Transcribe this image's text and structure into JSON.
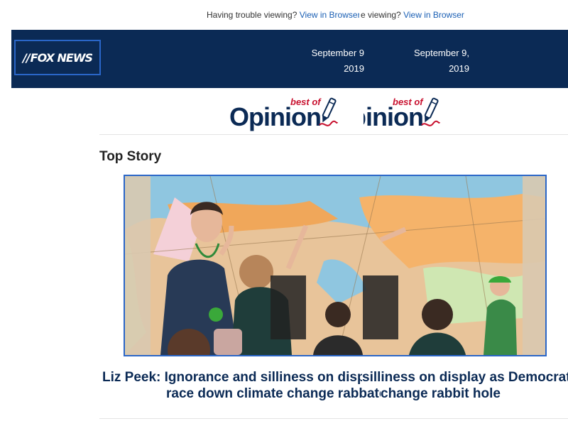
{
  "preheader": {
    "text": "Having trouble viewing?",
    "link": "View in Browser",
    "text_tail": " viewing?",
    "text_prefix_cut": "e"
  },
  "header": {
    "logo_text": "FOX NEWS",
    "date_line1": "September 9,",
    "date_line2": "2019",
    "date_cut_line1": "September 9",
    "date_cut_line2": "2019"
  },
  "opinion_logo": {
    "word": "Opinion",
    "tag": "best of"
  },
  "section": {
    "title": "Top Story"
  },
  "story": {
    "headline_line1_a": "Liz Peek: Ignorance and silliness on displ",
    "headline_line1_b": "silliness on display as Democrats",
    "headline_line2_a": "race down climate change rabbate",
    "headline_line2_b": "change rabbit hole"
  },
  "colors": {
    "brand_navy": "#0b2a55",
    "link_blue": "#1a5fb4",
    "accent_red": "#c8102e",
    "border_blue": "#2a66c8"
  }
}
